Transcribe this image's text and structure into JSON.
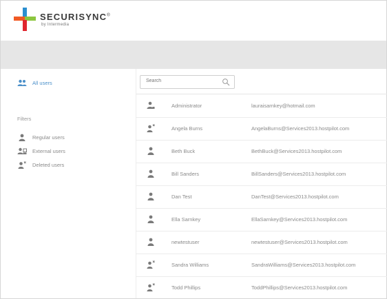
{
  "brand": {
    "name": "SECURISYNC",
    "trademark": "®",
    "subtitle": "by Intermedia",
    "colors": {
      "orange": "#f15a24",
      "blue": "#2b8fd0",
      "green": "#8cc63f",
      "red": "#e0262e"
    }
  },
  "sidebar": {
    "all_users": "All users",
    "filters_label": "Filters",
    "filters": [
      {
        "label": "Regular users",
        "icon": "user-icon"
      },
      {
        "label": "External users",
        "icon": "external-users-icon"
      },
      {
        "label": "Deleted users",
        "icon": "deleted-user-icon"
      }
    ],
    "accent": "#4a8fc9"
  },
  "search": {
    "placeholder": "Search"
  },
  "users": [
    {
      "name": "Administrator",
      "email": "lauraisarnkey@hotmail.com",
      "icon": "admin-user-icon"
    },
    {
      "name": "Angela Burns",
      "email": "AngelaBurns@Services2013.hostpilot.com",
      "icon": "deleted-user-icon"
    },
    {
      "name": "Beth Buck",
      "email": "BethBuck@Services2013.hostpilot.com",
      "icon": "user-icon"
    },
    {
      "name": "Bill Sanders",
      "email": "BillSanders@Services2013.hostpilot.com",
      "icon": "user-icon"
    },
    {
      "name": "Dan Test",
      "email": "DanTest@Services2013.hostpilot.com",
      "icon": "user-icon"
    },
    {
      "name": "Ella Sarnkey",
      "email": "EllaSarnkey@Services2013.hostpilot.com",
      "icon": "user-icon"
    },
    {
      "name": "newtestuser",
      "email": "newtestuser@Services2013.hostpilot.com",
      "icon": "user-icon"
    },
    {
      "name": "Sandra Williams",
      "email": "SandraWilliams@Services2013.hostpilot.com",
      "icon": "deleted-user-icon"
    },
    {
      "name": "Todd Phillips",
      "email": "ToddPhillips@Services2013.hostpilot.com",
      "icon": "deleted-user-icon"
    }
  ]
}
